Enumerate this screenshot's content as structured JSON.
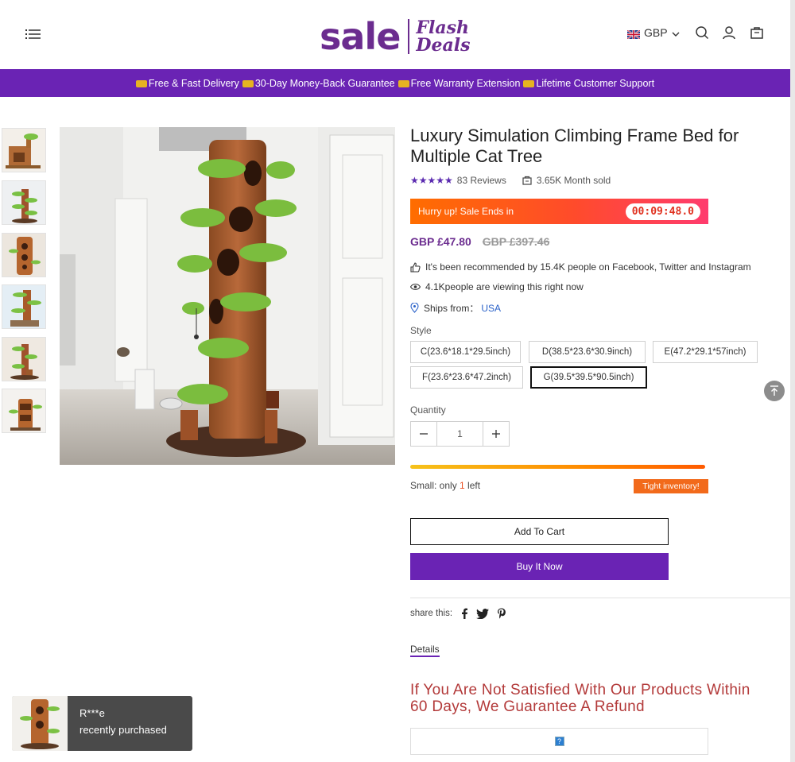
{
  "header": {
    "logo_main": "sale",
    "logo_sub_1": "Flash",
    "logo_sub_2": "Deals",
    "currency": "GBP",
    "icons": [
      "menu-icon",
      "search-icon",
      "account-icon",
      "cart-icon"
    ]
  },
  "announcement": {
    "items": [
      "Free & Fast Delivery",
      "30-Day Money-Back Guarantee",
      "Free Warranty Extension",
      "Lifetime Customer Support"
    ]
  },
  "product": {
    "title": "Luxury Simulation Climbing Frame Bed for Multiple Cat Tree",
    "stars": "★★★★★",
    "reviews": "83 Reviews",
    "sold": "3.65K Month sold",
    "sale_label": "Hurry up! Sale Ends in",
    "timer": "00:09:48.0",
    "price": "GBP £47.80",
    "old_price": "GBP £397.46",
    "recommend": "It's been recommended by 15.4K people on Facebook, Twitter and Instagram",
    "viewing": "4.1Kpeople are viewing this right now",
    "ships_label": "Ships from：",
    "ships_from": "USA",
    "style_label": "Style",
    "styles": [
      "C(23.6*18.1*29.5inch)",
      "D(38.5*23.6*30.9inch)",
      "E(47.2*29.1*57inch)",
      "F(23.6*23.6*47.2inch)",
      "G(39.5*39.5*90.5inch)"
    ],
    "selected_style": "G(39.5*39.5*90.5inch)",
    "quantity_label": "Quantity",
    "quantity": "1",
    "inventory_text_prefix": "Small: only ",
    "inventory_count": "1",
    "inventory_text_suffix": " left",
    "inventory_badge": "Tight inventory!",
    "add_to_cart": "Add To Cart",
    "buy_now": "Buy It Now",
    "share_label": "share this:",
    "details_tab": "Details",
    "guarantee": "If You Are Not Satisfied With Our Products Within 60 Days, We Guarantee A Refund",
    "broken_image_glyph": "?"
  },
  "popup": {
    "name": "R***e",
    "action": "recently purchased"
  },
  "colors": {
    "brand_purple": "#6a23b4",
    "logo_purple": "#6b2c8f",
    "guarantee_red": "#b33a3a",
    "badge_orange": "#f26a1b"
  }
}
